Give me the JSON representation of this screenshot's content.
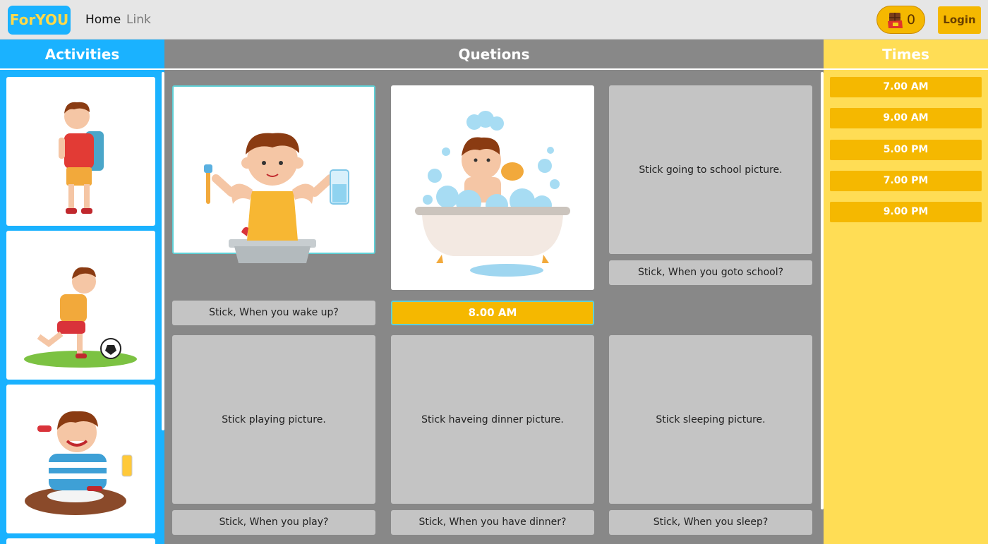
{
  "nav": {
    "brand": "ForYOU",
    "links": [
      "Home",
      "Link"
    ],
    "chocolate_count": "0",
    "login_label": "Login"
  },
  "columns": {
    "activities": "Activities",
    "questions": "Quetions",
    "times": "Times"
  },
  "activities": [
    {
      "icon": "boy-with-backpack-illustration"
    },
    {
      "icon": "boy-playing-football-illustration"
    },
    {
      "icon": "boy-eating-dinner-illustration"
    }
  ],
  "questions": [
    {
      "picture_text": "",
      "picture_icon": "boy-brushing-teeth-illustration",
      "label": "Stick, When you wake up?",
      "answer": ""
    },
    {
      "picture_text": "",
      "picture_icon": "boy-taking-bath-illustration",
      "label": "",
      "answer": "8.00 AM"
    },
    {
      "picture_text": "Stick going to school picture.",
      "label": "Stick, When you goto school?",
      "answer": ""
    },
    {
      "picture_text": "Stick playing picture.",
      "label": "Stick, When you play?",
      "answer": ""
    },
    {
      "picture_text": "Stick haveing dinner picture.",
      "label": "Stick, When you have dinner?",
      "answer": ""
    },
    {
      "picture_text": "Stick sleeping picture.",
      "label": "Stick, When you sleep?",
      "answer": ""
    }
  ],
  "times": [
    "7.00 AM",
    "9.00 AM",
    "5.00 PM",
    "7.00 PM",
    "9.00 PM"
  ],
  "colors": {
    "blue": "#1ab2ff",
    "yellow_panel": "#ffdd55",
    "gold": "#f5b800",
    "grey": "#888888",
    "card_grey": "#c4c4c4",
    "highlight": "#5fd0d6"
  }
}
